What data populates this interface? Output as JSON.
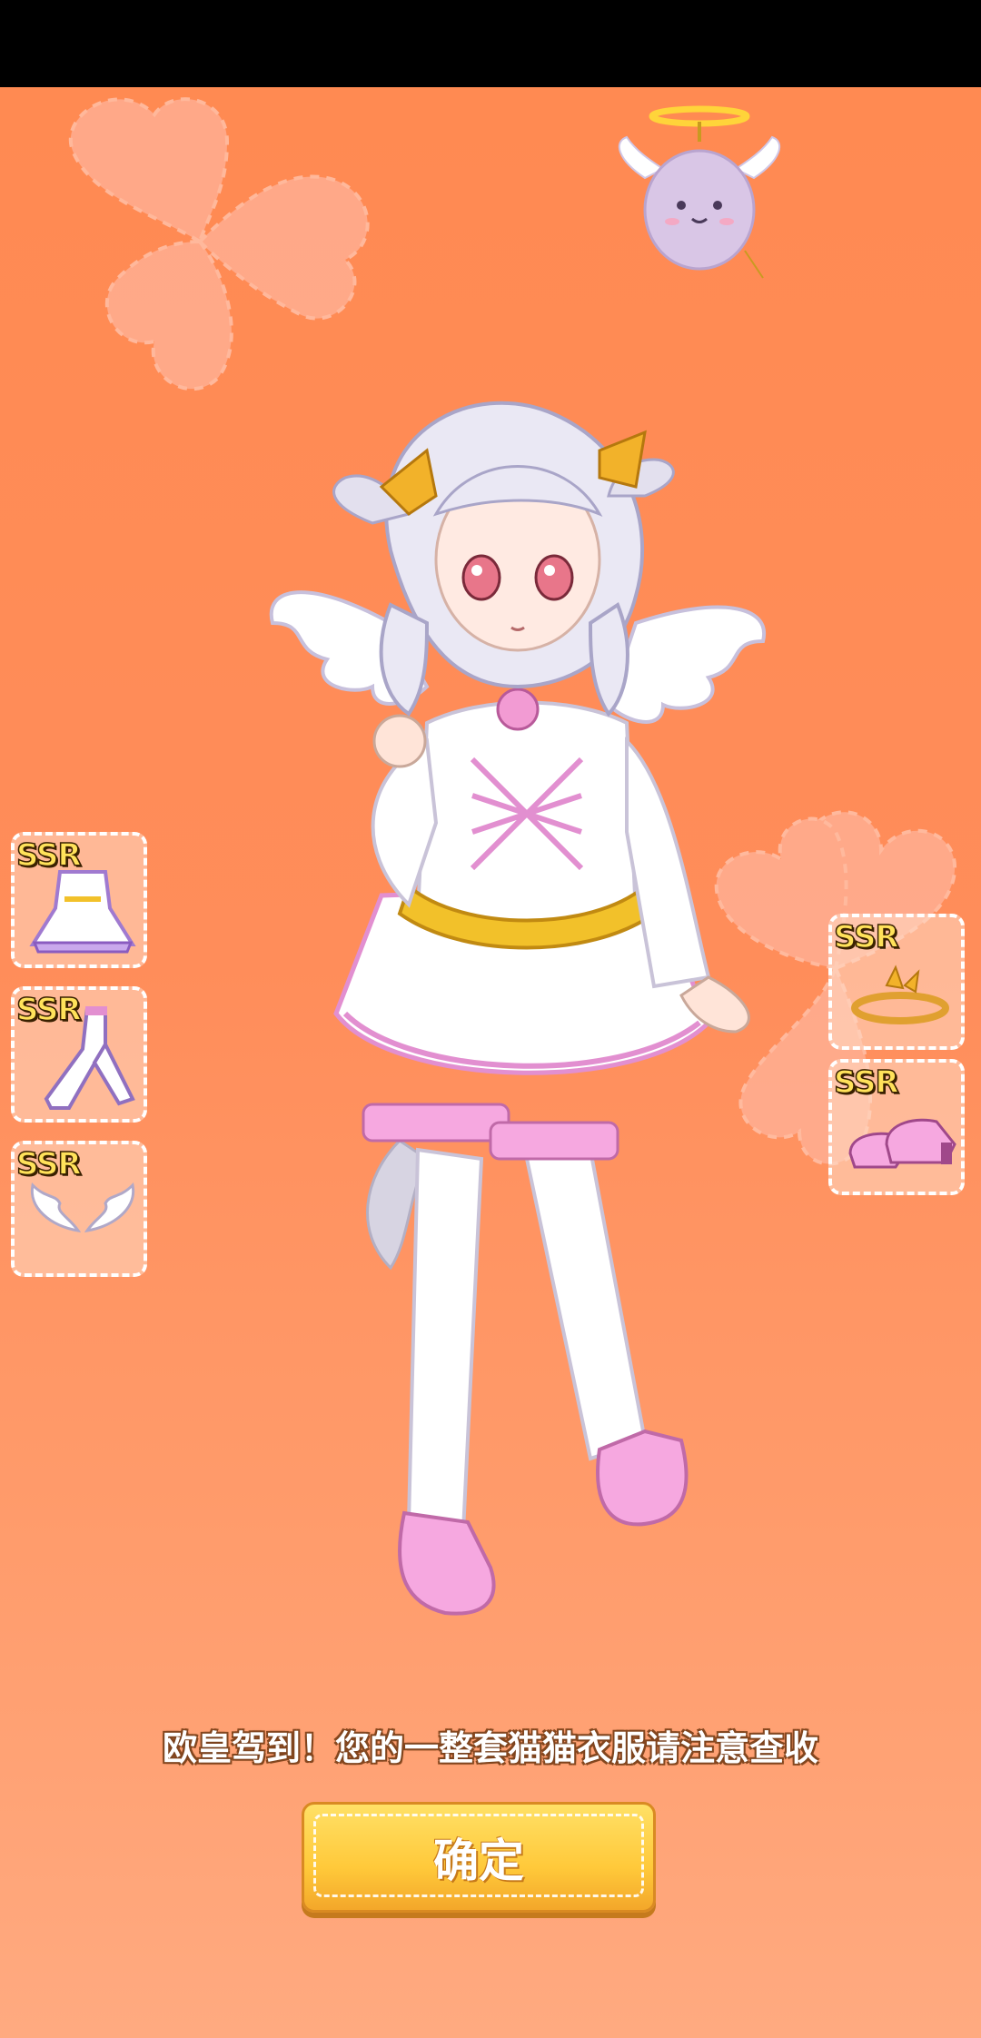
{
  "colors": {
    "background": "#ff8d5a",
    "badge": "#ffe25a",
    "button": "#ffc93a"
  },
  "left_items": [
    {
      "rarity": "SSR",
      "icon": "dress-icon"
    },
    {
      "rarity": "SSR",
      "icon": "stockings-icon"
    },
    {
      "rarity": "SSR",
      "icon": "wings-icon"
    }
  ],
  "right_items": [
    {
      "rarity": "SSR",
      "icon": "laurel-headband-icon"
    },
    {
      "rarity": "SSR",
      "icon": "shoes-icon"
    }
  ],
  "message": "欧皇驾到！您的一整套猫猫衣服请注意查收",
  "confirm_label": "确定"
}
